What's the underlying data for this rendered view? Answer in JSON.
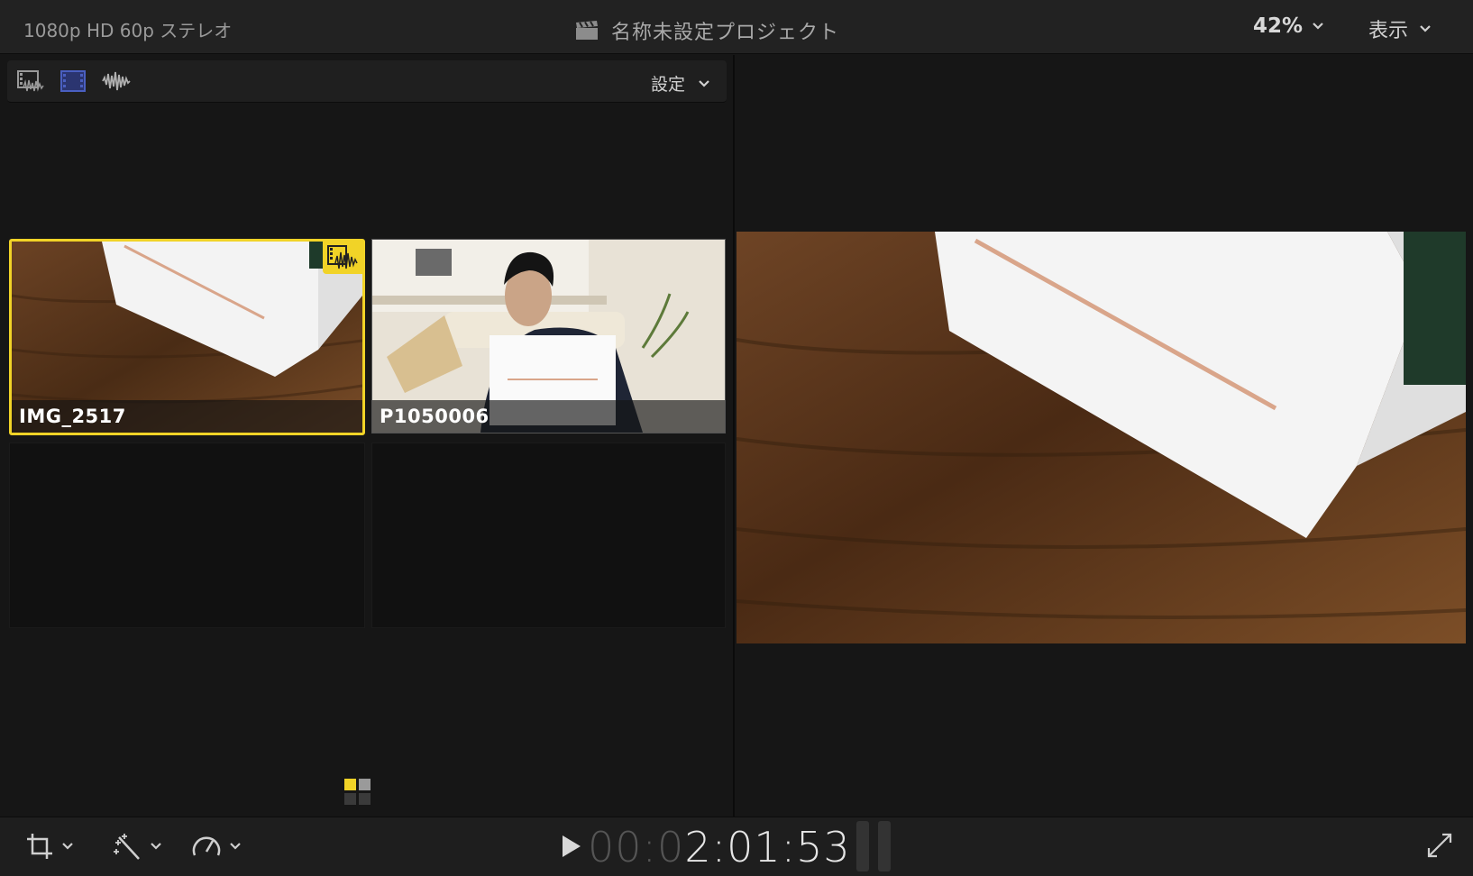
{
  "topbar": {
    "format_info": "1080p HD 60p ステレオ",
    "project_title": "名称未設定プロジェクト",
    "zoom_value": "42%",
    "view_label": "表示"
  },
  "browser": {
    "toolbar": {
      "icons": [
        "filmstrip-audio-icon",
        "filmstrip-icon",
        "waveform-icon"
      ],
      "settings_label": "設定"
    },
    "clips": [
      {
        "name": "IMG_2517",
        "selected": true,
        "badge": "video-audio-icon"
      },
      {
        "name": "P1050006",
        "selected": false
      }
    ]
  },
  "bottombar": {
    "timecode_dim": "00:0",
    "timecode_bright": "2:01:53",
    "tools": [
      "crop-icon",
      "enhance-wand-icon",
      "speed-gauge-icon"
    ]
  },
  "colors": {
    "accent_selection": "#f1d327",
    "toolbar_blue": "#4a5fc1"
  }
}
